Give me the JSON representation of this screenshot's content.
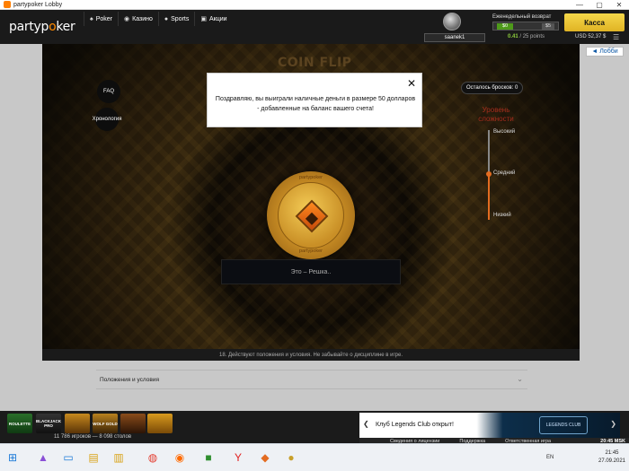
{
  "window": {
    "title": "partypoker Lobby",
    "controls": [
      "—",
      "▢",
      "✕"
    ]
  },
  "header": {
    "logo_part1": "party",
    "logo_part2": "p",
    "logo_part3": "ker",
    "nav": [
      {
        "label": "Poker",
        "icon": "spade-icon"
      },
      {
        "label": "Казино",
        "icon": "chip-icon"
      },
      {
        "label": "Sports",
        "icon": "ball-icon"
      },
      {
        "label": "Акции",
        "icon": "gift-icon"
      }
    ],
    "username": "saanek1",
    "cashback_label": "Еженедельный возврат",
    "cashback_left": "$0",
    "cashback_right": "$5",
    "points_value": "0.41",
    "points_total": "/ 25 points",
    "cashier_label": "Касса",
    "balance": "USD 52,37 $",
    "lobby_label": "◄ Лобби"
  },
  "game": {
    "title": "COIN FLIP",
    "faq_label": "FAQ",
    "history_label": "Хронология",
    "throws_label": "Осталось бросков: 0",
    "difficulty_title": "Уровень сложности",
    "levels": {
      "high": "Высокий",
      "medium": "Средний",
      "low": "Низкий"
    },
    "coin_text_top": "partypoker",
    "coin_text_bottom": "partypoker",
    "result_text": "Это – Решка..",
    "footnote": "18. Действуют положения и условия. Не забывайте о дисциплине в игре."
  },
  "modal": {
    "message": "Поздравляю, вы выиграли наличные деньги в размере 50 долларов - добавленные на баланс вашего счета!",
    "close_label": "✕"
  },
  "terms": {
    "label": "Положения и условия"
  },
  "bottom": {
    "slots": [
      "ROULETTE",
      "BLACKJACK PRO",
      "",
      "WOLF GOLD",
      "",
      ""
    ],
    "players_count": "11 786 игроков",
    "tables_count": "8 098 столов",
    "promo_text": "Клуб Legends Club открыт!",
    "promo_logo": "LEGENDS CLUB",
    "status_links": [
      "Сведения о лицензии",
      "Поддержка",
      "Ответственная игра"
    ],
    "status_time": "20:45 MSK"
  },
  "taskbar": {
    "lang": "EN",
    "time": "21:45",
    "date": "27.09.2021"
  }
}
